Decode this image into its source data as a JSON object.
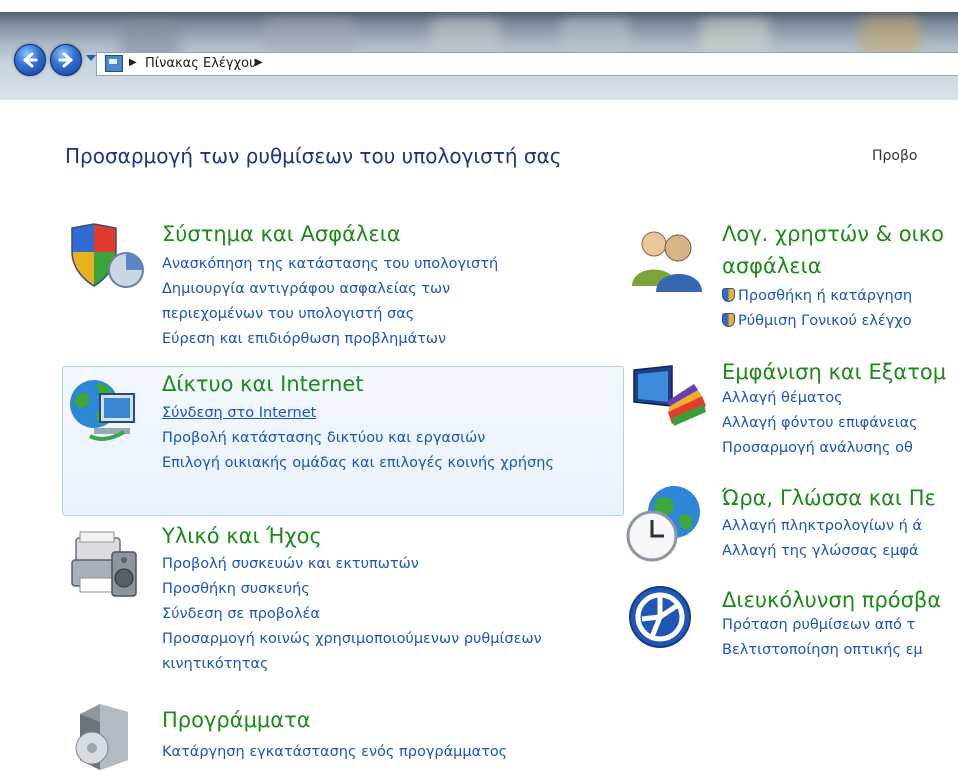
{
  "address_bar": {
    "breadcrumb": "Πίνακας Ελέγχου",
    "icons": [
      "back-arrow-icon",
      "forward-arrow-icon",
      "dropdown-chevron-icon",
      "control-panel-icon",
      "breadcrumb-arrow-icon"
    ]
  },
  "page": {
    "title": "Προσαρμογή των ρυθμίσεων του υπολογιστή σας",
    "view_label": "Προβο"
  },
  "categories_left": [
    {
      "title": "Σύστημα και Ασφάλεια",
      "icon": "security-shield-icon",
      "links": [
        "Ανασκόπηση της κατάστασης του υπολογιστή",
        "Δημιουργία αντιγράφου ασφαλείας των περιεχομένων του υπολογιστή σας",
        "Εύρεση και επιδιόρθωση προβλημάτων"
      ]
    },
    {
      "title": "Δίκτυο και Internet",
      "icon": "network-globe-icon",
      "links": [
        "Σύνδεση στο Internet",
        "Προβολή κατάστασης δικτύου και εργασιών",
        "Επιλογή οικιακής ομάδας και επιλογές κοινής χρήσης"
      ]
    },
    {
      "title": "Υλικό και Ήχος",
      "icon": "printer-speaker-icon",
      "links": [
        "Προβολή συσκευών και εκτυπωτών",
        "Προσθήκη συσκευής",
        "Σύνδεση σε προβολέα",
        "Προσαρμογή κοινώς χρησιμοποιούμενων ρυθμίσεων κινητικότητας"
      ]
    },
    {
      "title": "Προγράμματα",
      "icon": "programs-box-icon",
      "links": [
        "Κατάργηση εγκατάστασης ενός προγράμματος"
      ]
    }
  ],
  "categories_right": [
    {
      "title_line1": "Λογ. χρηστών & οικο",
      "title_line2": "ασφάλεια",
      "icon": "users-icon",
      "links": [
        "Προσθήκη ή κατάργηση",
        "Ρύθμιση Γονικού ελέγχο"
      ]
    },
    {
      "title": "Εμφάνιση και Εξατομ",
      "icon": "display-palette-icon",
      "links": [
        "Αλλαγή θέματος",
        "Αλλαγή φόντου επιφάνειας",
        "Προσαρμογή ανάλυσης οθ"
      ]
    },
    {
      "title": "Ώρα, Γλώσσα και Πε",
      "icon": "clock-globe-icon",
      "links": [
        "Αλλαγή πληκτρολογίων ή ά",
        "Αλλαγή της γλώσσας εμφά"
      ]
    },
    {
      "title": "Διευκόλυνση πρόσβα",
      "icon": "accessibility-icon",
      "links": [
        "Πρόταση ρυθμίσεων από τ",
        "Βελτιστοποίηση οπτικής εμ"
      ]
    }
  ]
}
